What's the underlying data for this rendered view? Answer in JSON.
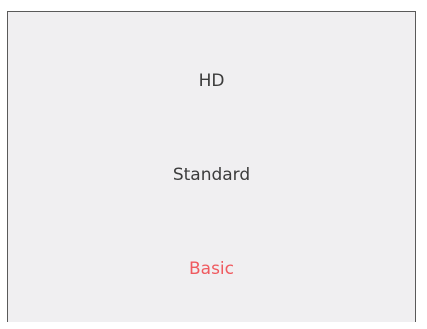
{
  "quality_options": [
    {
      "label": "HD",
      "selected": false
    },
    {
      "label": "Standard",
      "selected": false
    },
    {
      "label": "Basic",
      "selected": true
    }
  ],
  "colors": {
    "background": "#f0eff1",
    "text": "#3c3c3c",
    "selected_text": "#ef5a5f",
    "border": "#5a5a5a"
  }
}
